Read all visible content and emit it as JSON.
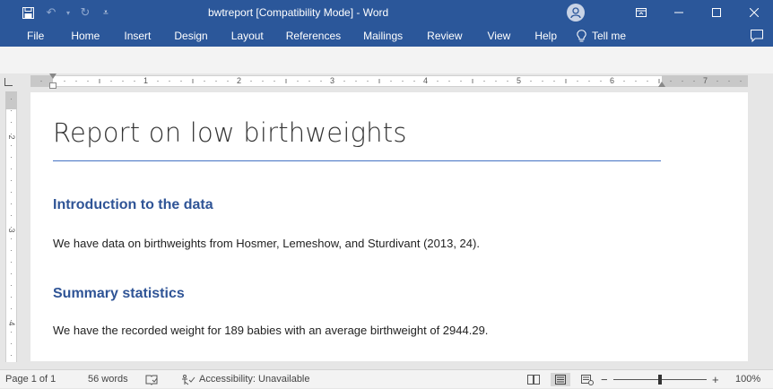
{
  "window": {
    "title": "bwtreport [Compatibility Mode]  -  Word"
  },
  "ribbon": {
    "tabs": [
      "File",
      "Home",
      "Insert",
      "Design",
      "Layout",
      "References",
      "Mailings",
      "Review",
      "View",
      "Help"
    ],
    "tell_me": "Tell me"
  },
  "ruler": {
    "numbers": [
      "1",
      "2",
      "3",
      "4",
      "5",
      "6",
      "7"
    ],
    "vertical_numbers": [
      "2",
      "3",
      "4"
    ]
  },
  "document": {
    "title": "Report on low birthweights",
    "sections": [
      {
        "heading": "Introduction to the data",
        "text": "We have data on birthweights from Hosmer, Lemeshow, and Sturdivant (2013, 24)."
      },
      {
        "heading": "Summary statistics",
        "text": "We have the recorded weight for 189 babies with an average birthweight of 2944.29."
      }
    ]
  },
  "status": {
    "page": "Page 1 of 1",
    "words": "56 words",
    "accessibility": "Accessibility: Unavailable",
    "zoom": "100%"
  },
  "colors": {
    "titlebar": "#2b579a",
    "heading2": "#2f5496",
    "rule": "#4472c4"
  }
}
